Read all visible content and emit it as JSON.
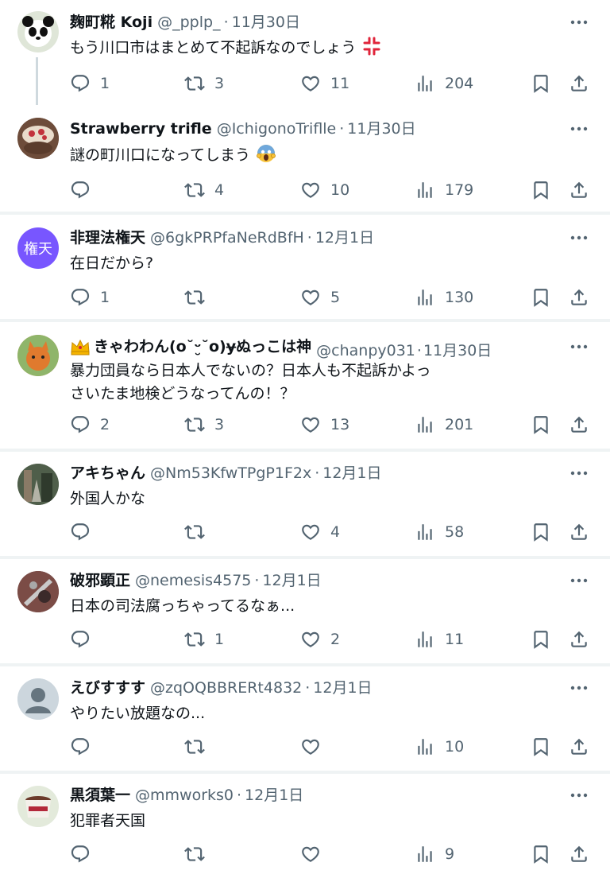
{
  "colors": {
    "text": "#0f1419",
    "secondary": "#536471",
    "divider": "#eff3f4"
  },
  "icons": [
    "reply-icon",
    "retweet-icon",
    "like-icon",
    "views-icon",
    "bookmark-icon",
    "share-icon",
    "more-icon"
  ],
  "tweets": [
    {
      "name": "麹町糀 Koji",
      "handle": "@_pplp_",
      "sep": "·",
      "date": "11月30日",
      "text": "もう川口市はまとめて不起訴なのでしょう",
      "emoji": "anger-symbol",
      "replies": "1",
      "retweets": "3",
      "likes": "11",
      "views": "204"
    },
    {
      "name": "Strawberry trifle",
      "handle": "@IchigonoTriflle",
      "sep": "·",
      "date": "11月30日",
      "text": "謎の町川口になってしまう",
      "emoji": "scream-face",
      "replies": "",
      "retweets": "4",
      "likes": "10",
      "views": "179"
    },
    {
      "name": "非理法権天",
      "avatar_text": "権天",
      "handle": "@6gkPRPfaNeRdBfH",
      "sep": "·",
      "date": "12月1日",
      "text": "在日だから?",
      "replies": "1",
      "retweets": "",
      "likes": "5",
      "views": "130"
    },
    {
      "name": "きゃわわん(o˘ᵕ̮˘o)ɏぬっこは神",
      "crown": "crown-emoji",
      "handle": "@chanpy031",
      "sep": "·",
      "date": "11月30日",
      "text": "暴力団員なら日本人でないの？日本人も不起訴かよっ",
      "text2": "さいたま地検どうなってんの！？",
      "replies": "2",
      "retweets": "3",
      "likes": "13",
      "views": "201"
    },
    {
      "name": "アキちゃん",
      "handle": "@Nm53KfwTPgP1F2x",
      "sep": "·",
      "date": "12月1日",
      "text": "外国人かな",
      "replies": "",
      "retweets": "",
      "likes": "4",
      "views": "58"
    },
    {
      "name": "破邪顕正",
      "handle": "@nemesis4575",
      "sep": "·",
      "date": "12月1日",
      "text": "日本の司法腐っちゃってるなぁ...",
      "replies": "",
      "retweets": "1",
      "likes": "2",
      "views": "11"
    },
    {
      "name": "えびすすす",
      "handle": "@zqOQBBRERt4832",
      "sep": "·",
      "date": "12月1日",
      "text": "やりたい放題なの...",
      "replies": "",
      "retweets": "",
      "likes": "",
      "views": "10"
    },
    {
      "name": "黒須葉一",
      "handle": "@mmworks0",
      "sep": "·",
      "date": "12月1日",
      "text": "犯罪者天国",
      "replies": "",
      "retweets": "",
      "likes": "",
      "views": "9"
    }
  ]
}
